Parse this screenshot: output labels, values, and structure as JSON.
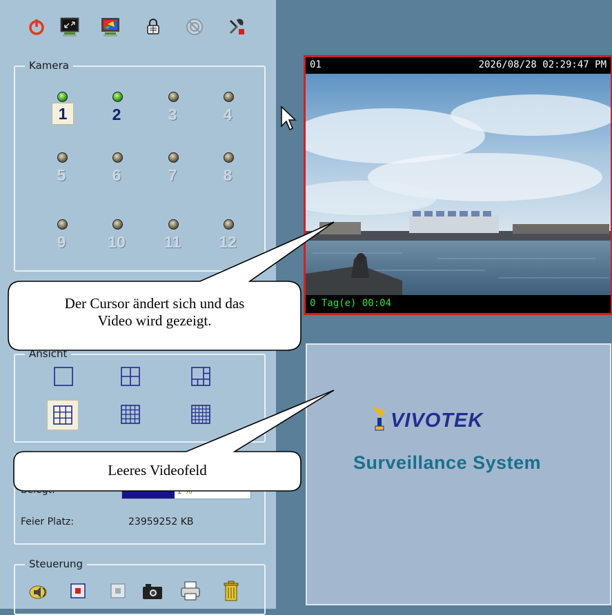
{
  "toolbar": {
    "icons": [
      "power-icon",
      "monitor-fullscreen-icon",
      "monitor-color-icon",
      "lock-icon",
      "disabled-settings-icon",
      "tools-icon"
    ]
  },
  "kamera": {
    "label": "Kamera",
    "cameras": [
      {
        "num": "1",
        "status": "on",
        "selected": true
      },
      {
        "num": "2",
        "status": "on",
        "selected": false
      },
      {
        "num": "3",
        "status": "off",
        "selected": false
      },
      {
        "num": "4",
        "status": "off",
        "selected": false
      },
      {
        "num": "5",
        "status": "off",
        "selected": false
      },
      {
        "num": "6",
        "status": "off",
        "selected": false
      },
      {
        "num": "7",
        "status": "off",
        "selected": false
      },
      {
        "num": "8",
        "status": "off",
        "selected": false
      },
      {
        "num": "9",
        "status": "off",
        "selected": false
      },
      {
        "num": "10",
        "status": "off",
        "selected": false
      },
      {
        "num": "11",
        "status": "off",
        "selected": false
      },
      {
        "num": "12",
        "status": "off",
        "selected": false
      }
    ]
  },
  "ansicht": {
    "label": "Ansicht",
    "layouts": [
      "1-view",
      "4-view",
      "6-view",
      "9-view",
      "13-view",
      "16-view"
    ],
    "selected_layout": "9-view"
  },
  "storage": {
    "belegt_label": "Belegt:",
    "belegt_value": "1 %",
    "belegt_fraction": 0.41,
    "frei_label": "Feier Platz:",
    "frei_value": "23959252 KB"
  },
  "steuerung": {
    "label": "Steuerung",
    "icons": [
      "audio-icon",
      "record-icon",
      "stop-icon",
      "snapshot-camera-icon",
      "print-icon",
      "delete-trash-icon"
    ]
  },
  "video": {
    "channel": "01",
    "timestamp": "2026/08/28 02:29:47 PM",
    "footer": "0 Tag(e) 00:04"
  },
  "empty_panel": {
    "brand": "VIVOTEK",
    "tagline": "Surveillance System"
  },
  "callouts": {
    "top_line1": "Der Cursor ändert sich und das",
    "top_line2": "Video wird gezeigt.",
    "bottom": "Leeres Videofeld"
  },
  "colors": {
    "panel_bg": "#a9c3d6",
    "background": "#5a7f98",
    "active_border": "#d61f1f",
    "footer_text": "#3fe23f",
    "brand": "#1f2e90"
  }
}
